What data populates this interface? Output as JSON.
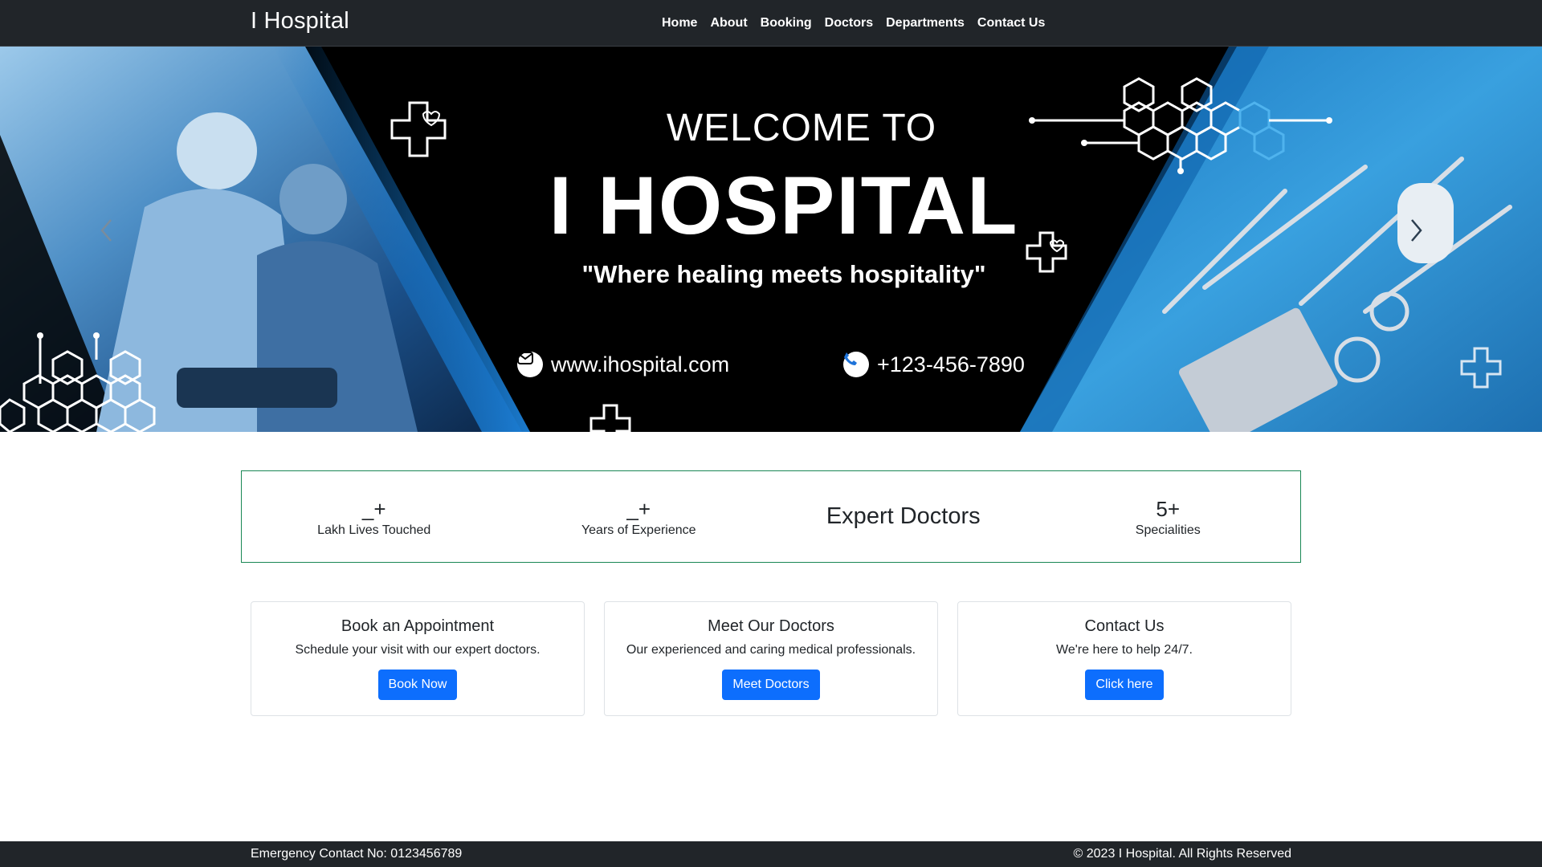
{
  "navbar": {
    "brand": "I Hospital",
    "links": [
      "Home",
      "About",
      "Booking",
      "Doctors",
      "Departments",
      "Contact Us"
    ]
  },
  "hero": {
    "welcome": "WELCOME TO",
    "title": "I HOSPITAL",
    "tagline": "\"Where healing meets hospitality\"",
    "website": "www.ihospital.com",
    "phone": "+123-456-7890",
    "prev_icon": "chevron-left-icon",
    "next_icon": "chevron-right-icon"
  },
  "stats": [
    {
      "value": "_+",
      "label": "Lakh Lives Touched"
    },
    {
      "value": "_+",
      "label": "Years of Experience"
    },
    {
      "value": "Expert Doctors",
      "label": ""
    },
    {
      "value": "5+",
      "label": "Specialities"
    }
  ],
  "cards": [
    {
      "title": "Book an Appointment",
      "text": "Schedule your visit with our expert doctors.",
      "button": "Book Now"
    },
    {
      "title": "Meet Our Doctors",
      "text": "Our experienced and caring medical professionals.",
      "button": "Meet Doctors"
    },
    {
      "title": "Contact Us",
      "text": "We're here to help 24/7.",
      "button": "Click here"
    }
  ],
  "footer": {
    "emergency": "Emergency Contact No: 0123456789",
    "copyright": "© 2023 I Hospital. All Rights Reserved"
  },
  "colors": {
    "navbar_bg": "#212529",
    "accent_blue": "#0d6efd",
    "stats_border": "#198754",
    "hero_blue": "#1d8fd6"
  }
}
